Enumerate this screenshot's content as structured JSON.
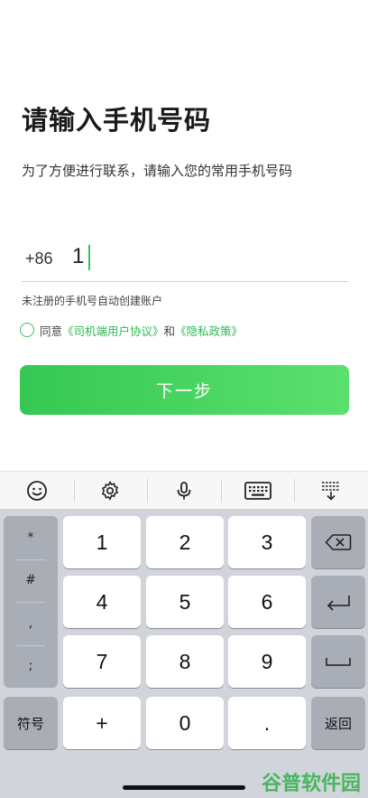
{
  "page": {
    "title": "请输入手机号码",
    "subtitle": "为了方便进行联系，请输入您的常用手机号码"
  },
  "phone": {
    "country_code": "+86",
    "value": "1"
  },
  "hint": "未注册的手机号自动创建账户",
  "agreement": {
    "prefix": "同意",
    "link1": "《司机端用户协议》",
    "and": "和",
    "link2": "《隐私政策》",
    "checked": false
  },
  "next_button": "下一步",
  "keyboard": {
    "toolbar_icons": [
      "emoji-icon",
      "gear-icon",
      "microphone-icon",
      "keyboard-icon",
      "keyboard-hide-icon"
    ],
    "symbols": [
      "*",
      "#",
      ",",
      ";"
    ],
    "keys": {
      "k1": "1",
      "k2": "2",
      "k3": "3",
      "k4": "4",
      "k5": "5",
      "k6": "6",
      "k7": "7",
      "k8": "8",
      "k9": "9",
      "plus": "+",
      "k0": "0",
      "dot": "."
    },
    "symbol_key": "符号",
    "return_key": "返回"
  },
  "watermark": "谷普软件园",
  "colors": {
    "accent": "#35c852",
    "link": "#2fba55",
    "keyboard_bg": "#d1d4da"
  }
}
